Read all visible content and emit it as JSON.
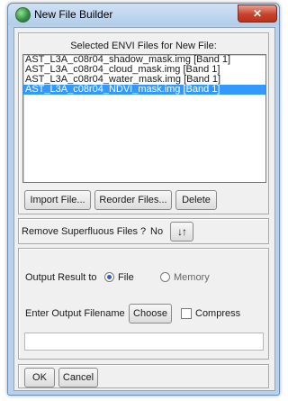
{
  "window": {
    "title": "New File Builder",
    "close_label": "✕",
    "icon": "envi-globe-icon"
  },
  "file_list": {
    "heading": "Selected ENVI Files for New File:",
    "items": [
      {
        "label": "AST_L3A_c08r04_shadow_mask.img [Band 1]",
        "selected": false
      },
      {
        "label": "AST_L3A_c08r04_cloud_mask.img [Band 1]",
        "selected": false
      },
      {
        "label": "AST_L3A_c08r04_water_mask.img [Band 1]",
        "selected": false
      },
      {
        "label": "AST_L3A_c08r04_NDVI_mask.img [Band 1]",
        "selected": true
      }
    ]
  },
  "buttons": {
    "import": "Import File...",
    "reorder": "Reorder Files...",
    "delete": "Delete"
  },
  "superfluous": {
    "label": "Remove Superfluous Files ?",
    "value": "No",
    "toggle_icon": "sort-arrows-icon",
    "toggle_glyph": "↓↑"
  },
  "output": {
    "label": "Output Result to",
    "options": [
      "File",
      "Memory"
    ],
    "selected": "File",
    "filename_label": "Enter Output Filename",
    "choose": "Choose",
    "compress_label": "Compress",
    "compress_checked": false,
    "filename_value": ""
  },
  "footer": {
    "ok": "OK",
    "cancel": "Cancel"
  }
}
